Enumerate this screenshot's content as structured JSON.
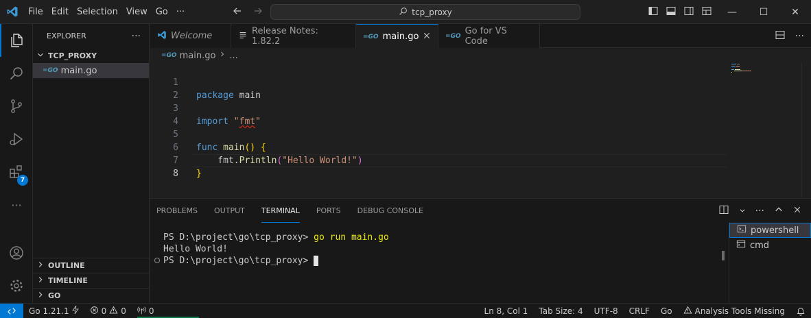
{
  "menu": [
    "File",
    "Edit",
    "Selection",
    "View",
    "Go"
  ],
  "menu_more": "···",
  "command_center": {
    "text": "tcp_proxy"
  },
  "window_controls": {
    "minimize": "—",
    "maximize": "☐",
    "close": "✕"
  },
  "activity": {
    "extensions_badge": "7"
  },
  "sidebar": {
    "title": "EXPLORER",
    "more": "···",
    "folder": "TCP_PROXY",
    "file": "main.go",
    "sections": [
      "OUTLINE",
      "TIMELINE",
      "GO"
    ]
  },
  "tabs": [
    {
      "label": "Welcome"
    },
    {
      "label": "Release Notes: 1.82.2"
    },
    {
      "label": "main.go"
    },
    {
      "label": "Go for VS Code"
    }
  ],
  "breadcrumb": {
    "file": "main.go",
    "more": "..."
  },
  "code": {
    "line_numbers": [
      "1",
      "2",
      "3",
      "4",
      "5",
      "6",
      "7",
      "8"
    ],
    "l1_kw": "package",
    "l1_name": " main",
    "l3_kw": "import",
    "l3_str_open": " \"",
    "l3_str_mid": "fmt",
    "l3_str_close": "\"",
    "l5_kw": "func",
    "l5_fn": " main",
    "l5_paren": "()",
    "l5_brace": " {",
    "l6_pkg": "    fmt.",
    "l6_fn": "Println",
    "l6_open": "(",
    "l6_str": "\"Hello World!\"",
    "l6_close": ")",
    "l7_brace": "}"
  },
  "panel": {
    "tabs": [
      "PROBLEMS",
      "OUTPUT",
      "TERMINAL",
      "PORTS",
      "DEBUG CONSOLE"
    ],
    "terminal_prompt_1": "PS D:\\project\\go\\tcp_proxy> ",
    "terminal_cmd": "go run main.go",
    "terminal_output": "Hello World!",
    "terminal_prompt_2": "PS D:\\project\\go\\tcp_proxy> ",
    "terminals": [
      "powershell",
      "cmd"
    ]
  },
  "status": {
    "go_version": "Go 1.21.1",
    "errors": "0",
    "warnings": "0",
    "ports": "0",
    "position": "Ln 8, Col 1",
    "tab_size": "Tab Size: 4",
    "encoding": "UTF-8",
    "eol": "CRLF",
    "language": "Go",
    "analysis": "Analysis Tools Missing"
  },
  "colors": {
    "accent": "#0078d4",
    "go": "#519aba",
    "background": "#1f1f1f"
  }
}
